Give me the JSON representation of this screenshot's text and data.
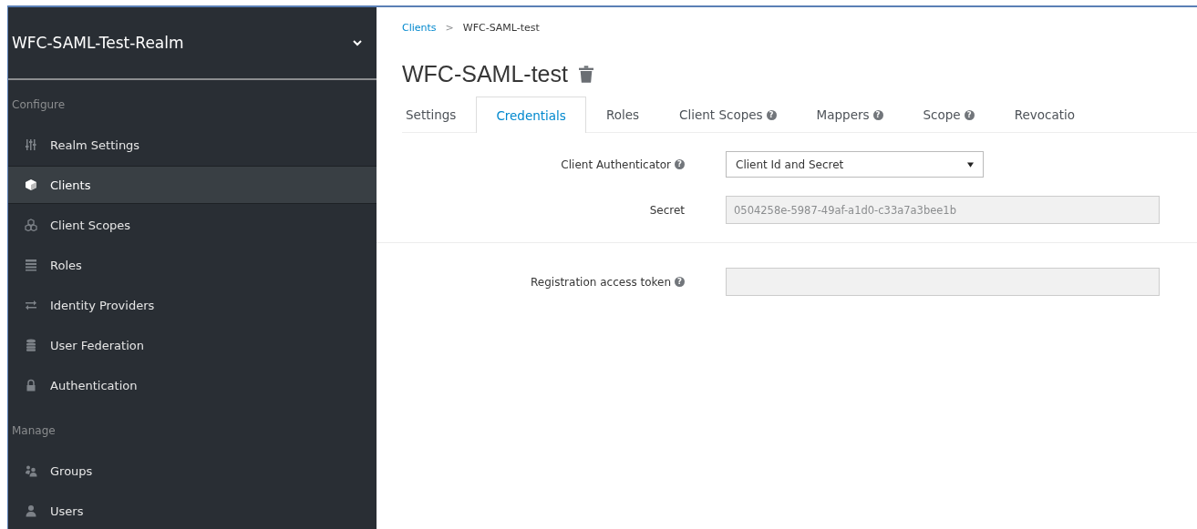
{
  "sidebar": {
    "realm": "WFC-SAML-Test-Realm",
    "sections": [
      {
        "title": "Configure",
        "items": [
          {
            "label": "Realm Settings",
            "selected": false
          },
          {
            "label": "Clients",
            "selected": true
          },
          {
            "label": "Client Scopes",
            "selected": false
          },
          {
            "label": "Roles",
            "selected": false
          },
          {
            "label": "Identity Providers",
            "selected": false
          },
          {
            "label": "User Federation",
            "selected": false
          },
          {
            "label": "Authentication",
            "selected": false
          }
        ]
      },
      {
        "title": "Manage",
        "items": [
          {
            "label": "Groups",
            "selected": false
          },
          {
            "label": "Users",
            "selected": false
          }
        ]
      }
    ]
  },
  "breadcrumb": {
    "link": "Clients",
    "separator": ">",
    "current": "WFC-SAML-test"
  },
  "title": "WFC-SAML-test",
  "tabs": [
    {
      "label": "Settings",
      "selected": false
    },
    {
      "label": "Credentials",
      "selected": true
    },
    {
      "label": "Roles",
      "selected": false
    },
    {
      "label": "Client Scopes",
      "selected": false,
      "help": "?"
    },
    {
      "label": "Mappers",
      "selected": false,
      "help": "?"
    },
    {
      "label": "Scope",
      "selected": false,
      "help": "?"
    },
    {
      "label": "Revocatio",
      "selected": false
    }
  ],
  "form_groups": [
    [
      {
        "kind": "select",
        "label": "Client Authenticator",
        "help": "?",
        "value": "Client Id and Secret"
      },
      {
        "kind": "input",
        "label": "Secret",
        "value": "0504258e-5987-49af-a1d0-c33a7a3bee1b"
      }
    ],
    [
      {
        "kind": "input",
        "label": "Registration access token",
        "help": "?"
      }
    ]
  ]
}
